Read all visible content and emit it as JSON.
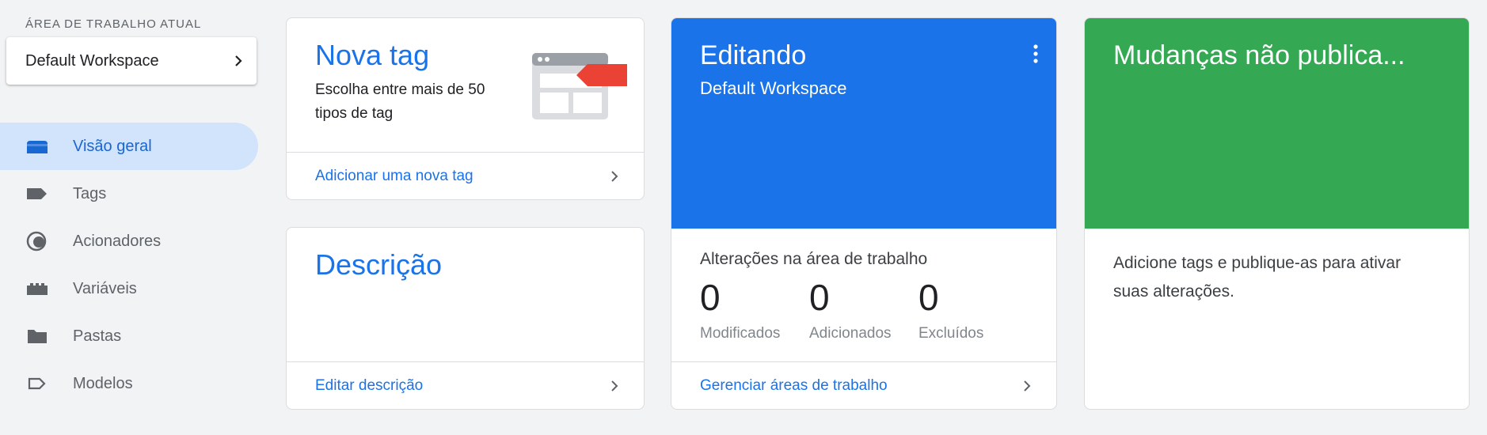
{
  "sidebar": {
    "workspace_label": "ÁREA DE TRABALHO ATUAL",
    "workspace_name": "Default Workspace",
    "items": [
      {
        "label": "Visão geral",
        "icon": "overview-icon"
      },
      {
        "label": "Tags",
        "icon": "tag-icon"
      },
      {
        "label": "Acionadores",
        "icon": "trigger-icon"
      },
      {
        "label": "Variáveis",
        "icon": "variables-icon"
      },
      {
        "label": "Pastas",
        "icon": "folder-icon"
      },
      {
        "label": "Modelos",
        "icon": "template-icon"
      }
    ],
    "active_index": 0
  },
  "new_tag_card": {
    "title": "Nova tag",
    "description": "Escolha entre mais de 50 tipos de tag",
    "link": "Adicionar uma nova tag"
  },
  "description_card": {
    "title": "Descrição",
    "link": "Editar descrição"
  },
  "editing_card": {
    "title": "Editando",
    "subtitle": "Default Workspace",
    "changes_title": "Alterações na área de trabalho",
    "stats": [
      {
        "value": "0",
        "label": "Modificados"
      },
      {
        "value": "0",
        "label": "Adicionados"
      },
      {
        "value": "0",
        "label": "Excluídos"
      }
    ],
    "link": "Gerenciar áreas de trabalho",
    "color": "#1a73e8"
  },
  "unpublished_card": {
    "title": "Mudanças não publica...",
    "text": "Adicione tags e publique-as para ativar suas alterações.",
    "color": "#34a853"
  },
  "colors": {
    "accent": "#1a73e8",
    "active_nav_bg": "#d2e3fc",
    "tag_red": "#ea4335"
  }
}
